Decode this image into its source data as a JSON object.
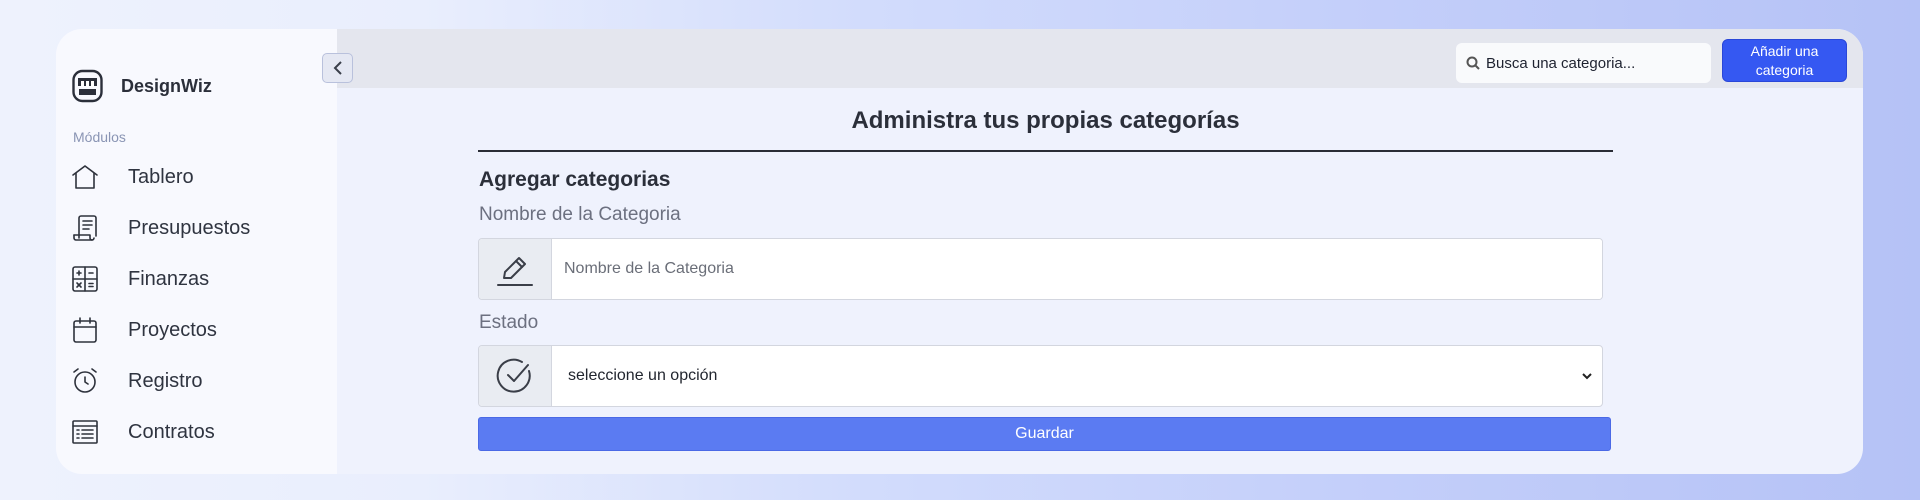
{
  "brand": {
    "name": "DesignWiz",
    "logo_icon": "app-logo-icon"
  },
  "sidebar": {
    "section_label": "Módulos",
    "items": [
      {
        "label": "Tablero",
        "icon": "home-icon"
      },
      {
        "label": "Presupuestos",
        "icon": "receipt-icon"
      },
      {
        "label": "Finanzas",
        "icon": "calculator-icon"
      },
      {
        "label": "Proyectos",
        "icon": "calendar-icon"
      },
      {
        "label": "Registro",
        "icon": "alarm-clock-icon"
      },
      {
        "label": "Contratos",
        "icon": "document-list-icon"
      }
    ]
  },
  "topbar": {
    "search_placeholder": "Busca una categoria...",
    "add_button": "Añadir una categoria"
  },
  "main": {
    "title": "Administra tus propias categorías",
    "subtitle": "Agregar categorias",
    "name_label": "Nombre de la Categoria",
    "name_placeholder": "Nombre de la Categoria",
    "status_label": "Estado",
    "status_selected": "seleccione un opción",
    "save_button": "Guardar"
  },
  "colors": {
    "accent": "#3558f2",
    "save_button": "#5b7bf2",
    "sidebar_bg": "#f8f9fe",
    "main_bg": "#eff2fd"
  }
}
